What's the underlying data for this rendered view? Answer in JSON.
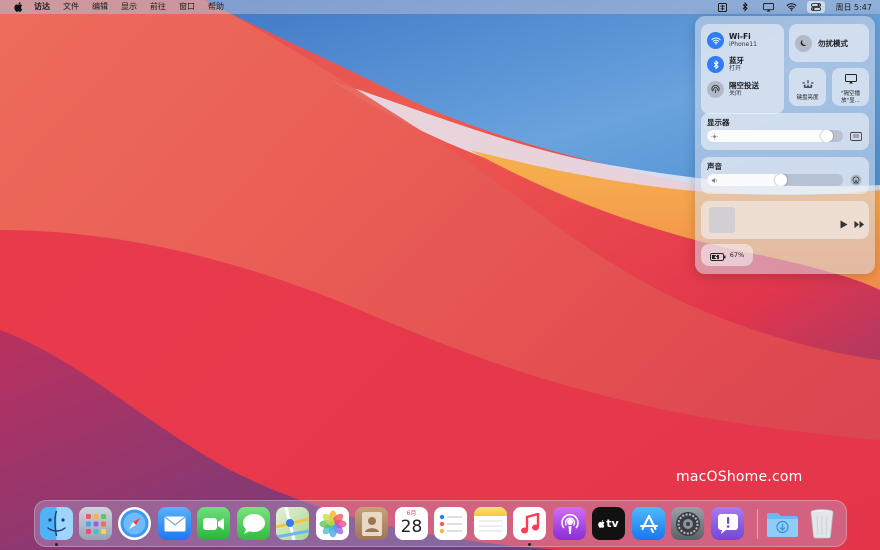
{
  "menubar": {
    "apple_icon": "apple-icon",
    "app_name": "访达",
    "menus": [
      "文件",
      "编辑",
      "显示",
      "前往",
      "窗口",
      "帮助"
    ],
    "status_icons": [
      "input-method-icon",
      "bluetooth-icon",
      "airplay-mirror-icon",
      "wifi-icon",
      "control-center-icon"
    ],
    "clock": "周日 5:47"
  },
  "control_center": {
    "wifi": {
      "label": "Wi-Fi",
      "sub": "iPhone11",
      "on": true
    },
    "bluetooth": {
      "label": "蓝牙",
      "sub": "打开",
      "on": true
    },
    "airdrop": {
      "label": "隔空投送",
      "sub": "关闭",
      "on": false
    },
    "dnd": {
      "label": "勿扰模式"
    },
    "keyboard_brightness": {
      "label": "键盘亮度"
    },
    "screen_mirroring": {
      "label": "\"隔空播放\"显..."
    },
    "display": {
      "label": "显示器",
      "level": 0.92
    },
    "sound": {
      "label": "声音",
      "level": 0.55
    },
    "battery": {
      "percent": "67%"
    }
  },
  "watermark": "macOShome.com",
  "dock": {
    "apps": [
      {
        "name": "finder",
        "icon": "finder-icon",
        "running": true
      },
      {
        "name": "launchpad",
        "icon": "launchpad-icon",
        "running": false
      },
      {
        "name": "safari",
        "icon": "safari-icon",
        "running": false
      },
      {
        "name": "mail",
        "icon": "mail-icon",
        "running": false
      },
      {
        "name": "facetime",
        "icon": "facetime-icon",
        "running": false
      },
      {
        "name": "messages",
        "icon": "messages-icon",
        "running": false
      },
      {
        "name": "maps",
        "icon": "maps-icon",
        "running": false
      },
      {
        "name": "photos",
        "icon": "photos-icon",
        "running": false
      },
      {
        "name": "contacts",
        "icon": "contacts-icon",
        "running": false
      },
      {
        "name": "calendar",
        "icon": "calendar-icon",
        "running": false
      },
      {
        "name": "reminders",
        "icon": "reminders-icon",
        "running": false
      },
      {
        "name": "notes",
        "icon": "notes-icon",
        "running": false
      },
      {
        "name": "music",
        "icon": "music-icon",
        "running": true
      },
      {
        "name": "podcasts",
        "icon": "podcasts-icon",
        "running": false
      },
      {
        "name": "tv",
        "icon": "apple-tv-icon",
        "running": false
      },
      {
        "name": "app-store",
        "icon": "app-store-icon",
        "running": false
      },
      {
        "name": "system-preferences",
        "icon": "system-preferences-icon",
        "running": false
      },
      {
        "name": "feedback-assistant",
        "icon": "feedback-assistant-icon",
        "running": false
      }
    ],
    "calendar_month": "6月",
    "calendar_day": "28",
    "tv_label": "tv",
    "downloads_icon": "downloads-folder-icon",
    "trash_icon": "trash-icon"
  },
  "colors": {
    "accent": "#2f7cf6"
  }
}
